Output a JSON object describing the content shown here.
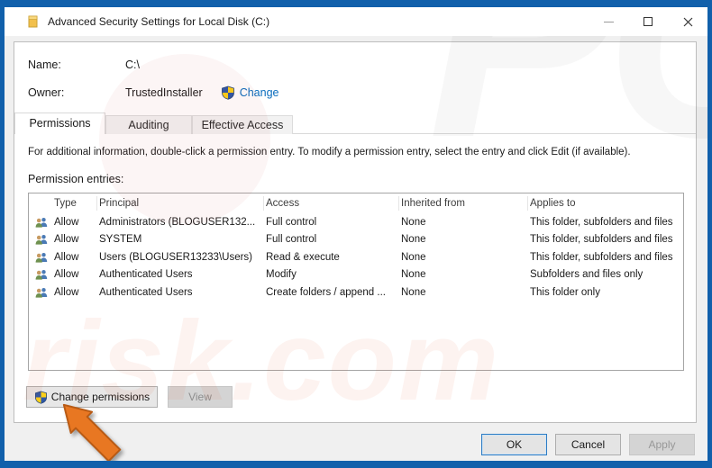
{
  "window": {
    "title": "Advanced Security Settings for Local Disk (C:)"
  },
  "fields": {
    "name_label": "Name:",
    "name_value": "C:\\",
    "owner_label": "Owner:",
    "owner_value": "TrustedInstaller",
    "change_link": "Change"
  },
  "tabs": [
    {
      "label": "Permissions",
      "active": true
    },
    {
      "label": "Auditing",
      "active": false
    },
    {
      "label": "Effective Access",
      "active": false
    }
  ],
  "info_text": "For additional information, double-click a permission entry. To modify a permission entry, select the entry and click Edit (if available).",
  "entries_label": "Permission entries:",
  "table": {
    "columns": [
      "Type",
      "Principal",
      "Access",
      "Inherited from",
      "Applies to"
    ],
    "rows": [
      {
        "type": "Allow",
        "principal": "Administrators (BLOGUSER132...",
        "access": "Full control",
        "inherited": "None",
        "applies": "This folder, subfolders and files"
      },
      {
        "type": "Allow",
        "principal": "SYSTEM",
        "access": "Full control",
        "inherited": "None",
        "applies": "This folder, subfolders and files"
      },
      {
        "type": "Allow",
        "principal": "Users (BLOGUSER13233\\Users)",
        "access": "Read & execute",
        "inherited": "None",
        "applies": "This folder, subfolders and files"
      },
      {
        "type": "Allow",
        "principal": "Authenticated Users",
        "access": "Modify",
        "inherited": "None",
        "applies": "Subfolders and files only"
      },
      {
        "type": "Allow",
        "principal": "Authenticated Users",
        "access": "Create folders / append ...",
        "inherited": "None",
        "applies": "This folder only"
      }
    ]
  },
  "buttons": {
    "change_permissions": "Change permissions",
    "view": "View",
    "ok": "OK",
    "cancel": "Cancel",
    "apply": "Apply"
  },
  "watermark": {
    "pc": "PC",
    "risk": "risk.com"
  },
  "colors": {
    "frame_blue": "#1160ab",
    "link_blue": "#0a6cbd",
    "shield_blue": "#2e58a6",
    "shield_yellow": "#fbd019",
    "arrow_orange": "#e87722",
    "focus_border": "#2d7cc4"
  }
}
